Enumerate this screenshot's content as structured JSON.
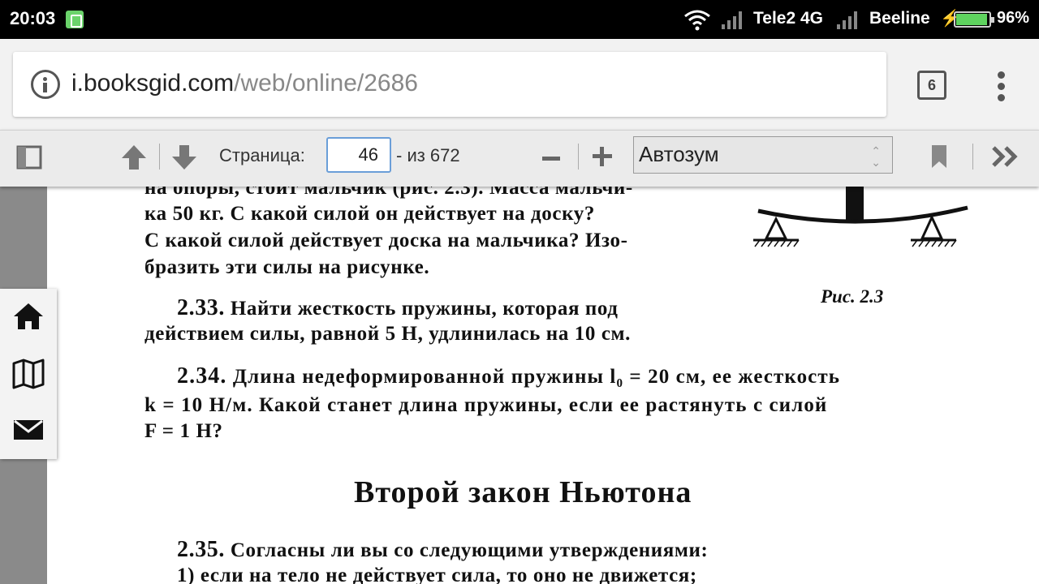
{
  "status_bar": {
    "time": "20:03",
    "carrier_1": "Tele2 4G",
    "carrier_2": "Beeline",
    "battery_percent": "96%",
    "battery_level": 0.96,
    "icons": [
      "notification-app-icon",
      "wifi-icon",
      "signal-icon",
      "signal-icon",
      "charging-icon",
      "battery-icon"
    ]
  },
  "browser": {
    "url_host": "i.booksgid.com",
    "url_path": "/web/online/2686",
    "tab_count": "6",
    "icons": [
      "info-icon",
      "tab-switcher-icon",
      "overflow-menu-icon"
    ]
  },
  "pdf_toolbar": {
    "page_label": "Страница:",
    "page_value": "46",
    "page_total": "- из 672",
    "zoom_value": "Автозум",
    "icons": [
      "sidebar-toggle-icon",
      "previous-page-icon",
      "next-page-icon",
      "zoom-out-icon",
      "zoom-in-icon",
      "bookmark-icon",
      "tools-icon"
    ]
  },
  "side_toolbar": {
    "icons": [
      "home-icon",
      "map-icon",
      "mail-icon"
    ]
  },
  "document": {
    "line_cut": "на опоры, стоит мальчик (рис. 2.3). Масса мальчи-",
    "line_1": "ка 50 кг. С какой силой он действует на доску?",
    "line_2": "С какой силой действует доска на мальчика? Изо-",
    "line_3": "бразить эти силы на рисунке.",
    "p233_num": "2.33.",
    "p233_line_1": "Найти жесткость пружины, которая под",
    "p233_line_2": "действием силы, равной 5 Н, удлинилась на 10 см.",
    "p234_num": "2.34.",
    "p234_line_1": "Длина недеформированной пружины l₀ = 20 см, ее жесткость",
    "p234_line_2": "k = 10 Н/м. Какой станет длина пружины, если ее растянуть с силой",
    "p234_line_3": "F = 1 Н?",
    "figure_caption": "Рис. 2.3",
    "heading": "Второй закон Ньютона",
    "p235_num": "2.35.",
    "p235_line_1": "Согласны ли вы со следующими утверждениями:",
    "p235_line_2": "1) если на тело не действует сила, то оно не движется;"
  }
}
